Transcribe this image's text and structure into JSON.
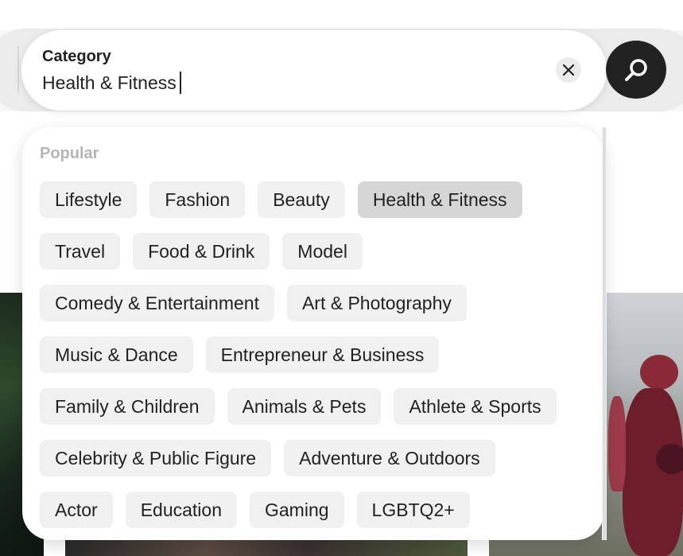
{
  "search": {
    "label": "Category",
    "value": "Health & Fitness",
    "clear_icon": "close-icon",
    "search_icon": "search-icon"
  },
  "dropdown": {
    "section_title": "Popular",
    "selected": "Health & Fitness",
    "rows": [
      [
        "Lifestyle",
        "Fashion",
        "Beauty",
        "Health & Fitness"
      ],
      [
        "Travel",
        "Food & Drink",
        "Model"
      ],
      [
        "Comedy & Entertainment",
        "Art & Photography"
      ],
      [
        "Music & Dance",
        "Entrepreneur & Business"
      ],
      [
        "Family & Children",
        "Animals & Pets",
        "Athlete & Sports"
      ],
      [
        "Celebrity & Public Figure",
        "Adventure & Outdoors"
      ],
      [
        "Actor",
        "Education",
        "Gaming",
        "LGBTQ2+"
      ]
    ]
  },
  "colors": {
    "accent_dark": "#222222",
    "chip_bg": "#f0f0f0",
    "chip_selected_bg": "#d6d6d6"
  }
}
